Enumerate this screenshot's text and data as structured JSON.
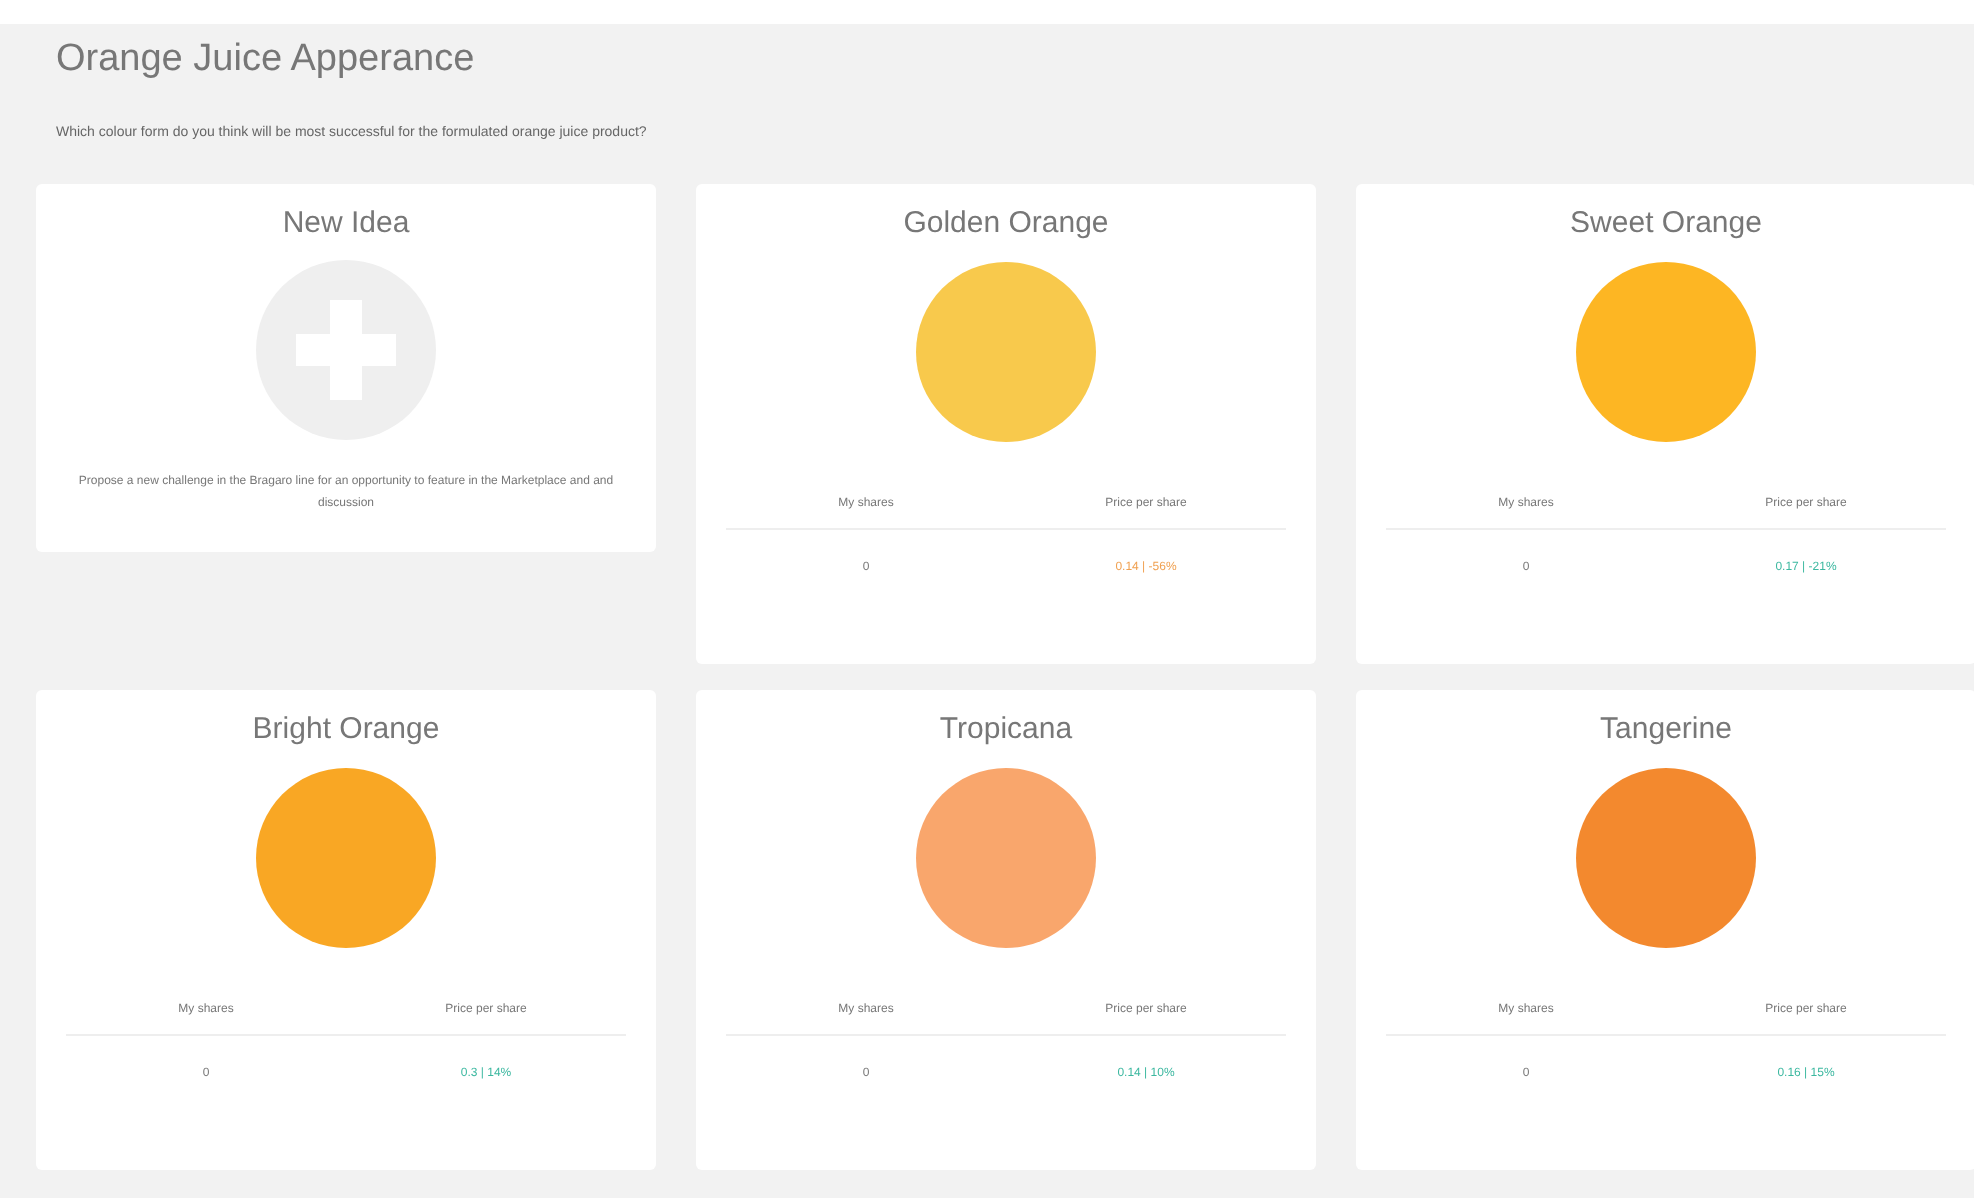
{
  "title": "Orange Juice Apperance",
  "question": "Which colour form do you think will be most successful for the formulated orange juice product?",
  "new_idea": {
    "title": "New Idea",
    "description": "Propose a new challenge in the Bragaro line for an opportunity to feature in the Marketplace and and discussion"
  },
  "cards": [
    {
      "name": "Golden Orange",
      "color": "#f8c94c",
      "shares_label": "My shares",
      "price_label": "Price per share",
      "shares": "0",
      "price": {
        "text": "0.14 | -56%",
        "color": "#f0a050"
      }
    },
    {
      "name": "Sweet Orange",
      "color": "#fdb623",
      "shares_label": "My shares",
      "price_label": "Price per share",
      "shares": "0",
      "price": {
        "text": "0.17 | -21%",
        "color": "#3cb8a0"
      }
    },
    {
      "name": "Bright Orange",
      "color": "#f9a724",
      "shares_label": "My shares",
      "price_label": "Price per share",
      "shares": "0",
      "price": {
        "text": "0.3 | 14%",
        "color": "#3cb8a0"
      }
    },
    {
      "name": "Tropicana",
      "color": "#f9a66c",
      "shares_label": "My shares",
      "price_label": "Price per share",
      "shares": "0",
      "price": {
        "text": "0.14 | 10%",
        "color": "#3cb8a0"
      }
    },
    {
      "name": "Tangerine",
      "color": "#f3892e",
      "shares_label": "My shares",
      "price_label": "Price per share",
      "shares": "0",
      "price": {
        "text": "0.16 | 15%",
        "color": "#3cb8a0"
      }
    }
  ]
}
